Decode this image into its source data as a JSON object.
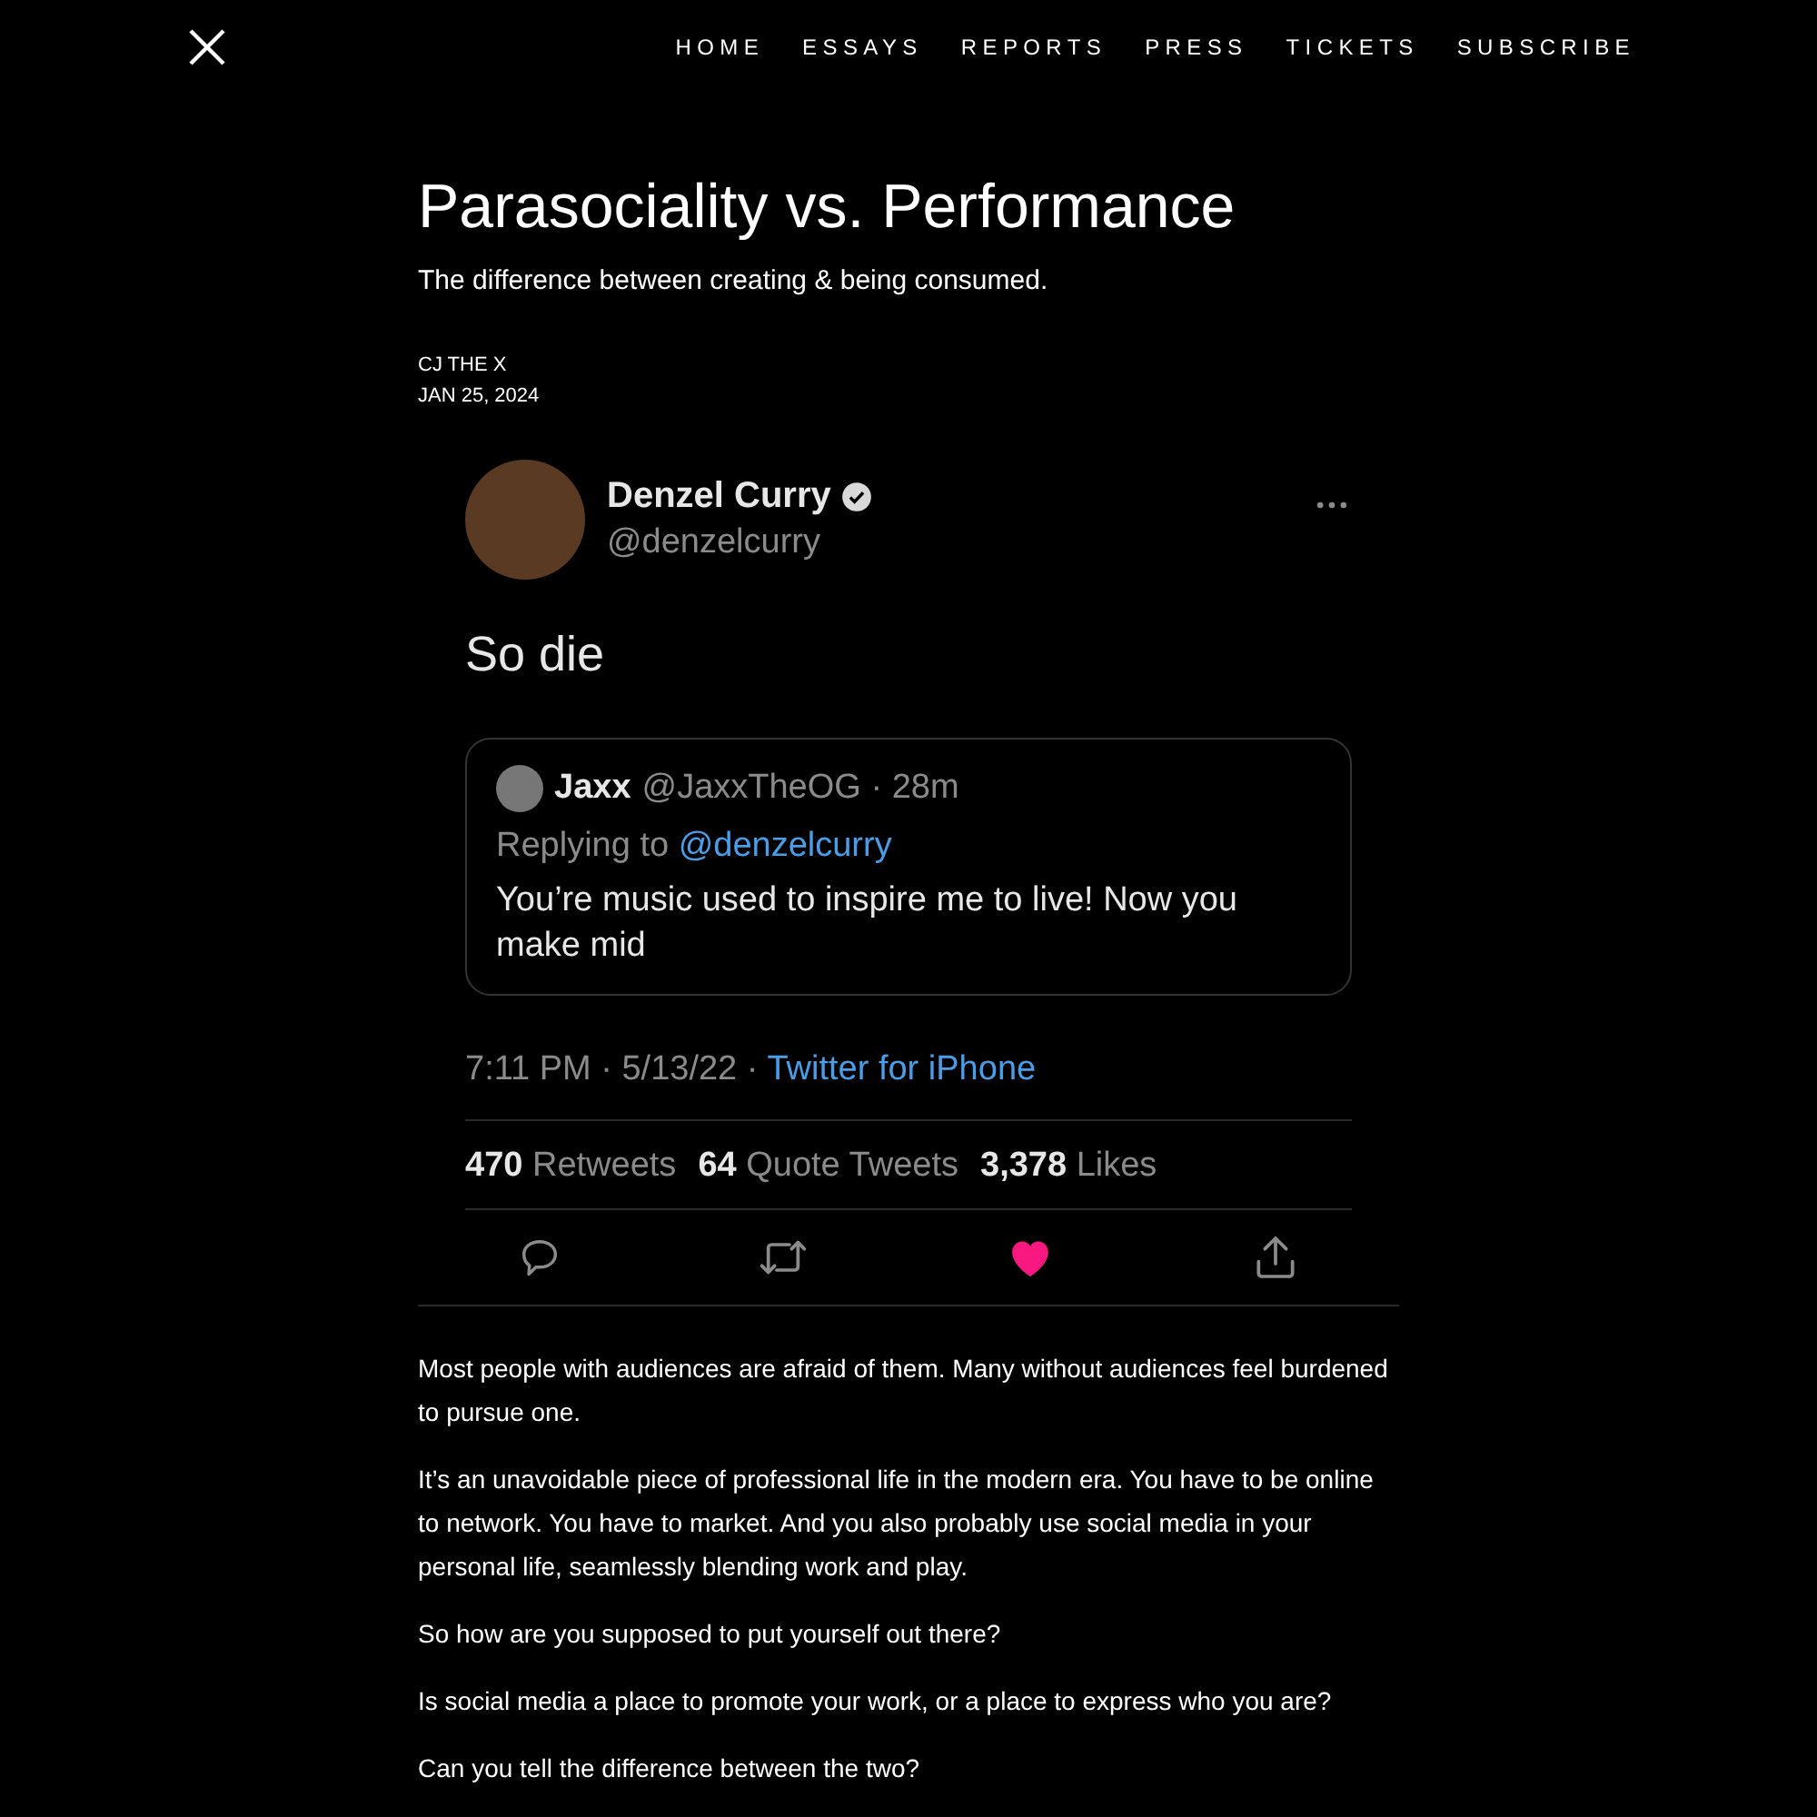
{
  "nav": {
    "links": [
      {
        "label": "HOME"
      },
      {
        "label": "ESSAYS"
      },
      {
        "label": "REPORTS"
      },
      {
        "label": "PRESS"
      },
      {
        "label": "TICKETS"
      },
      {
        "label": "SUBSCRIBE"
      }
    ]
  },
  "article": {
    "title": "Parasociality vs. Performance",
    "subtitle": "The difference between creating & being consumed.",
    "author": "CJ THE X",
    "date": "JAN 25, 2024"
  },
  "tweet": {
    "author": {
      "name": "Denzel Curry",
      "handle": "@denzelcurry",
      "verified": true
    },
    "text": "So die",
    "quote": {
      "name": "Jaxx",
      "handle_time": "@JaxxTheOG · 28m",
      "replying_prefix": "Replying to",
      "replying_to": "@denzelcurry",
      "text": "You’re music used to inspire me to live! Now you make mid"
    },
    "meta": "7:11 PM · 5/13/22 ·",
    "source": "Twitter for iPhone",
    "stats": [
      {
        "count": "470",
        "label": "Retweets"
      },
      {
        "count": "64",
        "label": "Quote Tweets"
      },
      {
        "count": "3,378",
        "label": "Likes"
      }
    ],
    "actions": [
      {
        "kind": "reply"
      },
      {
        "kind": "retweet"
      },
      {
        "kind": "like",
        "liked": true
      },
      {
        "kind": "share"
      }
    ]
  },
  "body": [
    "Most people with audiences are afraid of them. Many without audiences feel burdened to pursue one.",
    "It’s an unavoidable piece of professional life in the modern era. You have to be online to network. You have to market. And you also probably use social media in your personal life, seamlessly blending work and play.",
    "So how are you supposed to put yourself out there?",
    "Is social media a place to promote your work, or a place to express who you are?",
    "Can you tell the difference between the two?"
  ]
}
